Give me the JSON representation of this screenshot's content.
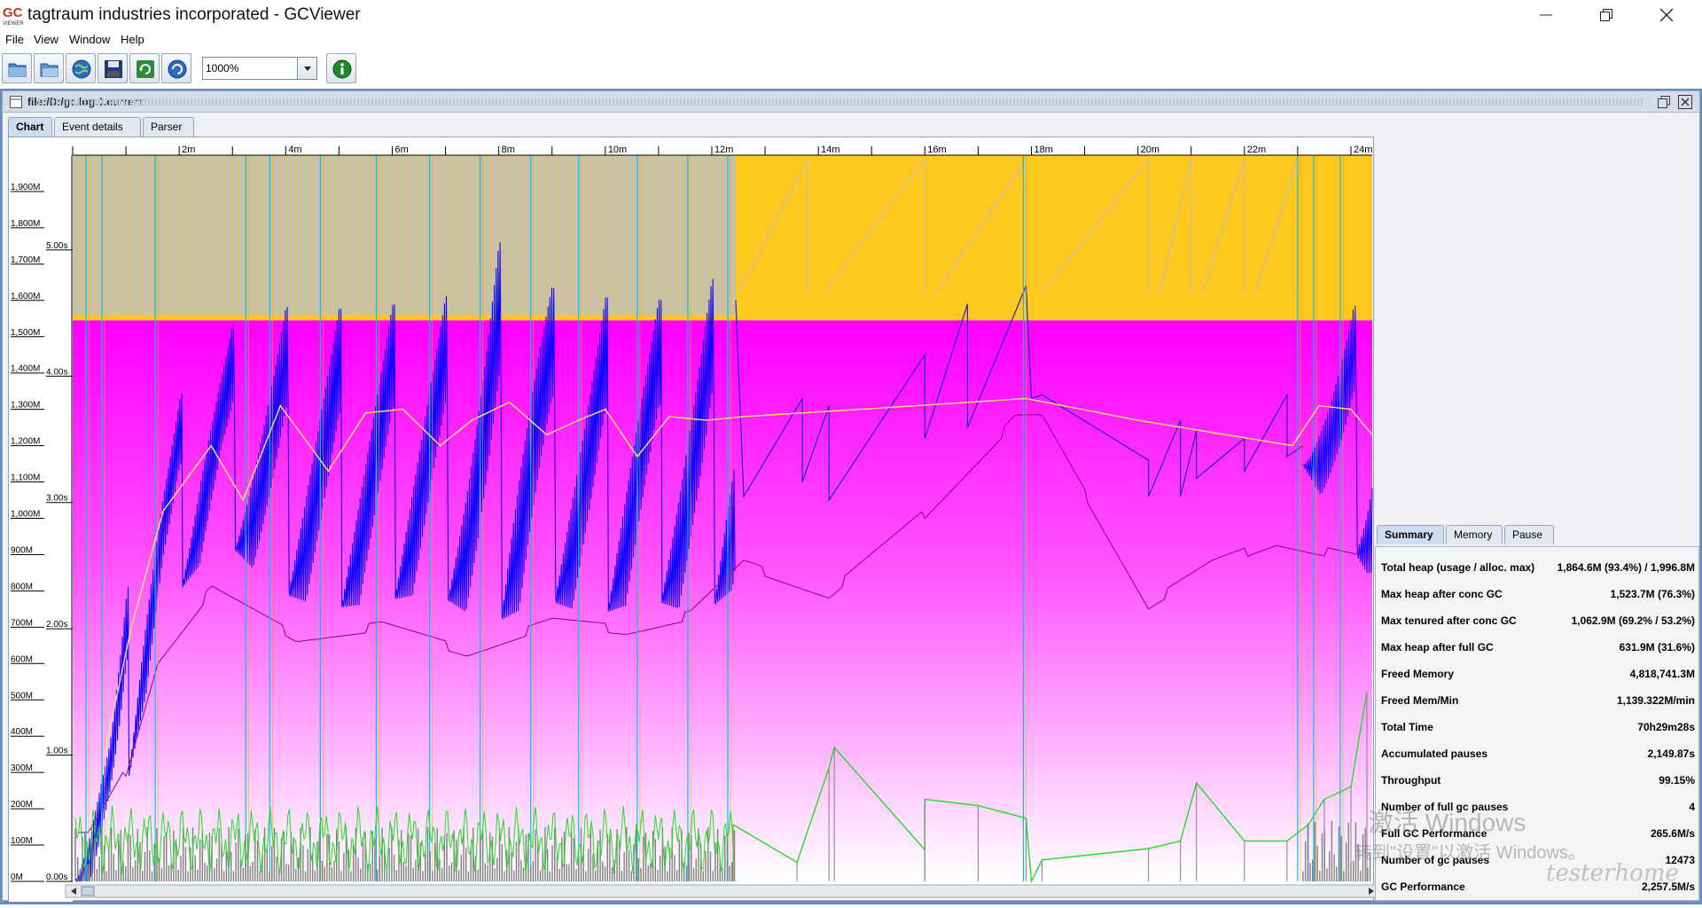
{
  "window": {
    "title": "tagtraum industries incorporated - GCViewer",
    "logo_text_top": "GC",
    "logo_text_bottom": "VIEWER"
  },
  "menu": [
    "File",
    "View",
    "Window",
    "Help"
  ],
  "toolbar": {
    "zoom_value": "1000%"
  },
  "document": {
    "path": "file:/D:/gc.log.0.current",
    "tabs": [
      "Chart",
      "Event details",
      "Parser"
    ],
    "active_tab": "Chart"
  },
  "chart_data": {
    "type": "line",
    "x_unit": "minutes",
    "x_ticks": [
      "2m",
      "4m",
      "6m",
      "8m",
      "10m",
      "12m",
      "14m",
      "16m",
      "18m",
      "20m",
      "22m",
      "24m"
    ],
    "x_range": [
      0,
      24.4
    ],
    "heap_ticks": [
      "0M",
      "100M",
      "200M",
      "300M",
      "400M",
      "500M",
      "600M",
      "700M",
      "800M",
      "900M",
      "1,000M",
      "1,100M",
      "1,200M",
      "1,300M",
      "1,400M",
      "1,500M",
      "1,600M",
      "1,700M",
      "1,800M",
      "1,900M"
    ],
    "heap_range_mb": [
      0,
      2000
    ],
    "pause_ticks": [
      "0.00s",
      "1.00s",
      "2.00s",
      "3.00s",
      "4.00s",
      "5.00s"
    ],
    "pause_range_s": [
      0,
      5.75
    ],
    "tenured_capacity_mb": 1545,
    "total_heap_mb": 2000,
    "colors": {
      "young_heap": "#ffc81e",
      "young_used_bg": "#bfbfbf",
      "tenured_area": "#ff00ff",
      "used_heap": "#0000ff",
      "used_tenured": "#8b008b",
      "pause_gc": "#22dd22",
      "pause_bars": "#808080",
      "full_gc_line": "#00bfff",
      "concurrent_lines": "#ffa500",
      "used_tenured_gc_line": "#ffe666"
    },
    "series": [
      {
        "key": "used_heap_peaks_mb",
        "points": [
          [
            0.1,
            350
          ],
          [
            0.7,
            500
          ],
          [
            1.3,
            1050
          ],
          [
            2.4,
            1480
          ],
          [
            3.4,
            1570
          ],
          [
            4.4,
            1590
          ],
          [
            5.4,
            1570
          ],
          [
            6.4,
            1600
          ],
          [
            7.4,
            1620
          ],
          [
            8.2,
            1800
          ],
          [
            9.2,
            1600
          ],
          [
            10.2,
            1610
          ],
          [
            11.2,
            1600
          ],
          [
            12.3,
            1680
          ],
          [
            13.8,
            1330
          ],
          [
            16.0,
            1450
          ],
          [
            16.8,
            1590
          ],
          [
            17.9,
            1640
          ],
          [
            20.2,
            1160
          ],
          [
            21.8,
            1340
          ],
          [
            22.6,
            1350
          ],
          [
            23.4,
            1560
          ],
          [
            24.2,
            1590
          ]
        ]
      },
      {
        "key": "used_heap_troughs_mb",
        "points": [
          [
            0.3,
            0
          ],
          [
            0.9,
            180
          ],
          [
            1.7,
            740
          ],
          [
            2.8,
            950
          ],
          [
            3.8,
            800
          ],
          [
            4.8,
            750
          ],
          [
            5.8,
            770
          ],
          [
            6.8,
            800
          ],
          [
            7.8,
            700
          ],
          [
            8.8,
            780
          ],
          [
            9.8,
            730
          ],
          [
            10.8,
            780
          ],
          [
            11.8,
            730
          ],
          [
            12.6,
            830
          ],
          [
            14.2,
            1050
          ],
          [
            16.0,
            1220
          ],
          [
            17.0,
            1280
          ],
          [
            18.0,
            1340
          ],
          [
            20.2,
            1070
          ],
          [
            21.0,
            1100
          ],
          [
            22.0,
            1130
          ],
          [
            23.0,
            1170
          ],
          [
            24.3,
            850
          ]
        ]
      },
      {
        "key": "tenured_used_mb",
        "points": [
          [
            0.3,
            110
          ],
          [
            1.0,
            290
          ],
          [
            1.6,
            600
          ],
          [
            2.6,
            790
          ],
          [
            4.2,
            660
          ],
          [
            5.8,
            690
          ],
          [
            7.4,
            620
          ],
          [
            9.0,
            700
          ],
          [
            10.4,
            680
          ],
          [
            11.6,
            720
          ],
          [
            12.6,
            860
          ],
          [
            14.2,
            780
          ],
          [
            16.0,
            1000
          ],
          [
            17.7,
            1260
          ],
          [
            18.2,
            1260
          ],
          [
            20.2,
            750
          ],
          [
            21.4,
            860
          ],
          [
            22.6,
            925
          ],
          [
            24.3,
            870
          ]
        ]
      },
      {
        "key": "used_heap_after_gc_mb",
        "points": [
          [
            0.6,
            350
          ],
          [
            1.1,
            700
          ],
          [
            1.7,
            1020
          ],
          [
            2.6,
            1200
          ],
          [
            3.2,
            1050
          ],
          [
            3.9,
            1310
          ],
          [
            4.8,
            1130
          ],
          [
            5.5,
            1290
          ],
          [
            6.2,
            1300
          ],
          [
            6.9,
            1200
          ],
          [
            7.5,
            1270
          ],
          [
            8.2,
            1320
          ],
          [
            8.9,
            1230
          ],
          [
            9.5,
            1270
          ],
          [
            10.0,
            1300
          ],
          [
            10.6,
            1170
          ],
          [
            11.2,
            1280
          ],
          [
            11.9,
            1270
          ],
          [
            12.6,
            1280
          ],
          [
            14.8,
            1300
          ],
          [
            17.9,
            1330
          ],
          [
            20.0,
            1270
          ],
          [
            22.9,
            1200
          ],
          [
            23.4,
            1310
          ],
          [
            24.0,
            1300
          ],
          [
            24.4,
            1230
          ]
        ]
      },
      {
        "key": "gc_pause_s",
        "points": [
          [
            12.4,
            0.45
          ],
          [
            13.6,
            0.15
          ],
          [
            14.2,
            0.9
          ],
          [
            14.3,
            1.06
          ],
          [
            16.0,
            0.25
          ],
          [
            16.0,
            0.65
          ],
          [
            17.0,
            0.6
          ],
          [
            17.9,
            0.5
          ],
          [
            18.0,
            0.0
          ],
          [
            18.2,
            0.17
          ],
          [
            20.2,
            0.26
          ],
          [
            20.8,
            0.32
          ],
          [
            21.1,
            0.78
          ],
          [
            22.0,
            0.32
          ],
          [
            22.8,
            0.32
          ],
          [
            23.2,
            0.45
          ],
          [
            23.5,
            0.65
          ],
          [
            24.0,
            0.75
          ],
          [
            24.3,
            1.5
          ]
        ]
      }
    ],
    "full_gc_x": [
      0.25,
      0.55,
      1.55,
      3.25,
      3.7,
      4.65,
      5.7,
      6.7,
      7.65,
      8.6,
      9.5,
      10.6,
      11.55,
      12.3,
      17.85,
      23.0,
      23.3,
      23.8
    ]
  },
  "summary": {
    "tabs": [
      "Summary",
      "Memory",
      "Pause"
    ],
    "active_tab": "Summary",
    "rows": [
      {
        "label": "Total heap (usage / alloc. max)",
        "value": "1,864.6M (93.4%) / 1,996.8M"
      },
      {
        "label": "Max heap after conc GC",
        "value": "1,523.7M (76.3%)"
      },
      {
        "label": "Max tenured after conc GC",
        "value": "1,062.9M (69.2% / 53.2%)"
      },
      {
        "label": "Max heap after full GC",
        "value": "631.9M (31.6%)"
      },
      {
        "label": "Freed Memory",
        "value": "4,818,741.3M"
      },
      {
        "label": "Freed Mem/Min",
        "value": "1,139.322M/min"
      },
      {
        "label": "Total Time",
        "value": "70h29m28s"
      },
      {
        "label": "Accumulated pauses",
        "value": "2,149.87s"
      },
      {
        "label": "Throughput",
        "value": "99.15%"
      },
      {
        "label": "Number of full gc pauses",
        "value": "4"
      },
      {
        "label": "Full GC Performance",
        "value": "265.6M/s"
      },
      {
        "label": "Number of gc pauses",
        "value": "12473"
      },
      {
        "label": "GC Performance",
        "value": "2,257.5M/s"
      }
    ]
  },
  "watermark": {
    "line1": "激活 Windows",
    "line2": "转到\"设置\"以激活 Windows。",
    "line3": "testerhome"
  }
}
